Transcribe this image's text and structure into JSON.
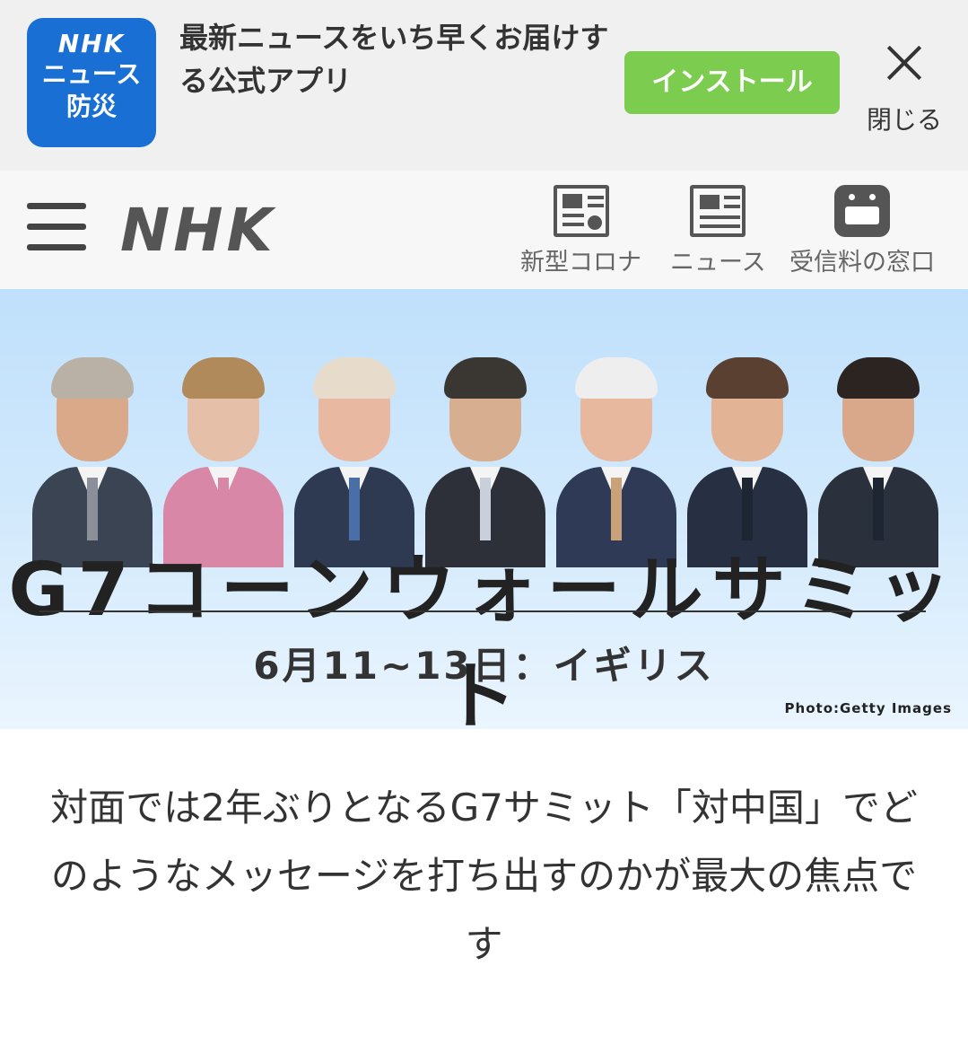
{
  "app_banner": {
    "icon_logo": "NHK",
    "icon_line1": "ニュース",
    "icon_line2": "防災",
    "text": "最新ニュースをいち早くお届けする公式アプリ",
    "install_label": "インストール",
    "close_label": "閉じる"
  },
  "header": {
    "logo": "NHK",
    "nav": [
      {
        "label": "新型コロナ",
        "icon": "newspaper-virus-icon"
      },
      {
        "label": "ニュース",
        "icon": "newspaper-icon"
      },
      {
        "label": "受信料の窓口",
        "icon": "domo-kun-icon"
      }
    ]
  },
  "hero": {
    "title": "G7コーンウォールサミット",
    "date": "6月11~13日：イギリス",
    "credit": "Photo:Getty Images",
    "portrait_colors": [
      {
        "skin": "#d9a98a",
        "hair": "#b9b0a6",
        "suit": "#3b4452",
        "tie": "#8a8f9a"
      },
      {
        "skin": "#e6bfa8",
        "hair": "#b08a5a",
        "suit": "#d987a6",
        "tie": "#d987a6"
      },
      {
        "skin": "#e8b9a0",
        "hair": "#e7dccc",
        "suit": "#2d3a52",
        "tie": "#4a6fa8"
      },
      {
        "skin": "#d8ae90",
        "hair": "#3a3632",
        "suit": "#2d3038",
        "tie": "#c9d0dc"
      },
      {
        "skin": "#e7b79e",
        "hair": "#eeeeee",
        "suit": "#2e3a56",
        "tie": "#c9a27a"
      },
      {
        "skin": "#e2b395",
        "hair": "#5a4030",
        "suit": "#263042",
        "tie": "#1f2633"
      },
      {
        "skin": "#d9a78a",
        "hair": "#2c2420",
        "suit": "#2a303c",
        "tie": "#1f2633"
      }
    ]
  },
  "lead": "対面では2年ぶりとなるG7サミット「対中国」でどのようなメッセージを打ち出すのかが最大の焦点です"
}
